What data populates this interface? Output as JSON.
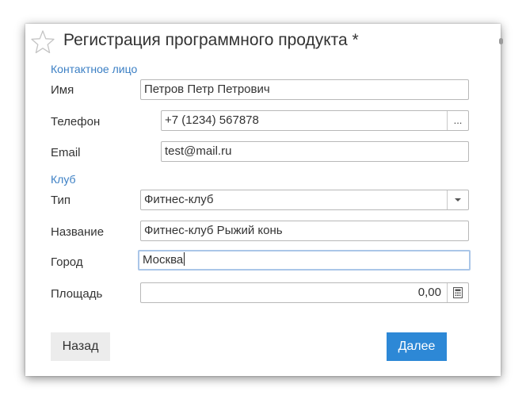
{
  "dialog": {
    "title": "Регистрация программного продукта *",
    "favorite_icon": "star-icon"
  },
  "contact": {
    "section_label": "Контактное лицо",
    "name_label": "Имя",
    "name_value": "Петров Петр Петрович",
    "phone_label": "Телефон",
    "phone_value": "+7 (1234) 567878",
    "phone_button": "...",
    "email_label": "Email",
    "email_value": "test@mail.ru"
  },
  "club": {
    "section_label": "Клуб",
    "type_label": "Тип",
    "type_value": "Фитнес-клуб",
    "type_dropdown_icon": "chevron-down-icon",
    "name_label": "Название",
    "name_value": "Фитнес-клуб Рыжий конь",
    "city_label": "Город",
    "city_value": "Москва",
    "area_label": "Площадь",
    "area_value": "0,00",
    "area_calc_icon": "calculator-icon"
  },
  "buttons": {
    "back": "Назад",
    "next": "Далее"
  },
  "colors": {
    "accent": "#2d88d6",
    "section": "#3b7fc4",
    "focus_border": "#aac6e8"
  }
}
